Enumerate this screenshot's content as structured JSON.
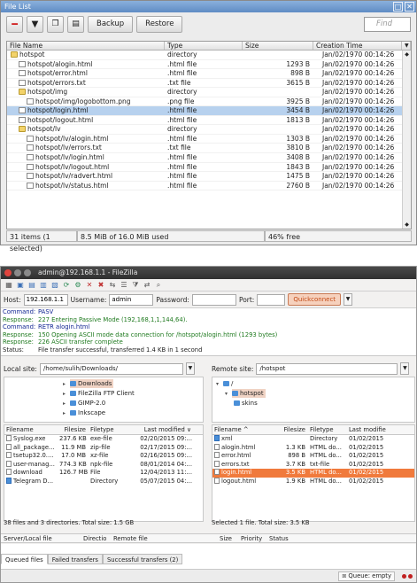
{
  "winbox": {
    "title": "File List",
    "toolbar": {
      "backup_label": "Backup",
      "restore_label": "Restore",
      "find_placeholder": "Find"
    },
    "columns": [
      "File Name",
      "Type",
      "Size",
      "Creation Time"
    ],
    "rows": [
      {
        "name": "hotspot",
        "type": "directory",
        "size": "",
        "time": "Jan/02/1970 00:14:26",
        "kind": "dir",
        "indent": 0
      },
      {
        "name": "hotspot/alogin.html",
        "type": ".html file",
        "size": "1293 B",
        "time": "Jan/02/1970 00:14:26",
        "kind": "file",
        "indent": 1
      },
      {
        "name": "hotspot/error.html",
        "type": ".html file",
        "size": "898 B",
        "time": "Jan/02/1970 00:14:26",
        "kind": "file",
        "indent": 1
      },
      {
        "name": "hotspot/errors.txt",
        "type": ".txt file",
        "size": "3615 B",
        "time": "Jan/02/1970 00:14:26",
        "kind": "file",
        "indent": 1
      },
      {
        "name": "hotspot/img",
        "type": "directory",
        "size": "",
        "time": "Jan/02/1970 00:14:26",
        "kind": "dir",
        "indent": 1
      },
      {
        "name": "hotspot/img/logobottom.png",
        "type": ".png file",
        "size": "3925 B",
        "time": "Jan/02/1970 00:14:26",
        "kind": "file",
        "indent": 2
      },
      {
        "name": "hotspot/login.html",
        "type": ".html file",
        "size": "3454 B",
        "time": "Jan/02/1970 00:14:26",
        "kind": "file",
        "indent": 1,
        "selected": true
      },
      {
        "name": "hotspot/logout.html",
        "type": ".html file",
        "size": "1813 B",
        "time": "Jan/02/1970 00:14:26",
        "kind": "file",
        "indent": 1
      },
      {
        "name": "hotspot/lv",
        "type": "directory",
        "size": "",
        "time": "Jan/02/1970 00:14:26",
        "kind": "dir",
        "indent": 1
      },
      {
        "name": "hotspot/lv/alogin.html",
        "type": ".html file",
        "size": "1303 B",
        "time": "Jan/02/1970 00:14:26",
        "kind": "file",
        "indent": 2
      },
      {
        "name": "hotspot/lv/errors.txt",
        "type": ".txt file",
        "size": "3810 B",
        "time": "Jan/02/1970 00:14:26",
        "kind": "file",
        "indent": 2
      },
      {
        "name": "hotspot/lv/login.html",
        "type": ".html file",
        "size": "3408 B",
        "time": "Jan/02/1970 00:14:26",
        "kind": "file",
        "indent": 2
      },
      {
        "name": "hotspot/lv/logout.html",
        "type": ".html file",
        "size": "1843 B",
        "time": "Jan/02/1970 00:14:26",
        "kind": "file",
        "indent": 2
      },
      {
        "name": "hotspot/lv/radvert.html",
        "type": ".html file",
        "size": "1475 B",
        "time": "Jan/02/1970 00:14:26",
        "kind": "file",
        "indent": 2
      },
      {
        "name": "hotspot/lv/status.html",
        "type": ".html file",
        "size": "2760 B",
        "time": "Jan/02/1970 00:14:26",
        "kind": "file",
        "indent": 2
      }
    ],
    "status": {
      "items": "31 items (1 selected)",
      "used": "8.5 MiB of 16.0 MiB used",
      "free": "46% free"
    }
  },
  "filezilla": {
    "title": "admin@192.168.1.1 - FileZilla",
    "quickconnect": {
      "host_label": "Host:",
      "host_value": "192.168.1.1",
      "user_label": "Username:",
      "user_value": "admin",
      "pass_label": "Password:",
      "port_label": "Port:",
      "button_label": "Quickconnect"
    },
    "log": [
      {
        "key": "Command:",
        "text": "PASV",
        "color": "navy"
      },
      {
        "key": "Response:",
        "text": "227 Entering Passive Mode (192,168,1,1,144,64).",
        "color": "green"
      },
      {
        "key": "Command:",
        "text": "RETR alogin.html",
        "color": "navy"
      },
      {
        "key": "Response:",
        "text": "150 Opening ASCII mode data connection for /hotspot/alogin.html (1293 bytes)",
        "color": "green"
      },
      {
        "key": "Response:",
        "text": "226 ASCII transfer complete",
        "color": "green"
      },
      {
        "key": "Status:",
        "text": "File transfer successful, transferred 1.4 KB in 1 second",
        "color": "plain"
      }
    ],
    "local": {
      "label": "Local site:",
      "path": "/home/sulih/Downloads/",
      "tree": [
        "Downloads",
        "FileZilla FTP Client",
        "GIMP-2.0",
        "Inkscape"
      ],
      "columns": [
        "Filename",
        "Filesize",
        "Filetype",
        "Last modified"
      ],
      "sort_indicator": "∨",
      "files": [
        {
          "name": "Syslog.exe",
          "size": "237.6 KB",
          "type": "exe-file",
          "mod": "02/20/2015 09:...",
          "dir": false
        },
        {
          "name": "all_package...",
          "size": "11.9 MB",
          "type": "zip-file",
          "mod": "02/17/2015 09:...",
          "dir": false
        },
        {
          "name": "tsetup32.0....",
          "size": "17.0 MB",
          "type": "xz-file",
          "mod": "02/16/2015 09:...",
          "dir": false
        },
        {
          "name": "user-manag...",
          "size": "774.3 KB",
          "type": "npk-file",
          "mod": "08/01/2014 04:...",
          "dir": false
        },
        {
          "name": "download",
          "size": "126.7 MB",
          "type": "File",
          "mod": "12/04/2013 11:...",
          "dir": false
        },
        {
          "name": "Telegram D...",
          "size": "",
          "type": "Directory",
          "mod": "05/07/2015 04:...",
          "dir": true
        }
      ],
      "status": "38 files and 3 directories. Total size: 1.5 GB"
    },
    "remote": {
      "label": "Remote site:",
      "path": "/hotspot",
      "tree_root": "/",
      "tree_items": [
        "hotspot",
        "skins"
      ],
      "columns": [
        "Filename",
        "Filesize",
        "Filetype",
        "Last modifie"
      ],
      "sort_indicator": "^",
      "files": [
        {
          "name": "xml",
          "size": "",
          "type": "Directory",
          "mod": "01/02/2015",
          "dir": true,
          "hl": false
        },
        {
          "name": "alogin.html",
          "size": "1.3 KB",
          "type": "HTML do...",
          "mod": "01/02/2015",
          "dir": false,
          "hl": false
        },
        {
          "name": "error.html",
          "size": "898 B",
          "type": "HTML do...",
          "mod": "01/02/2015",
          "dir": false,
          "hl": false
        },
        {
          "name": "errors.txt",
          "size": "3.7 KB",
          "type": "txt-file",
          "mod": "01/02/2015",
          "dir": false,
          "hl": false
        },
        {
          "name": "login.html",
          "size": "3.5 KB",
          "type": "HTML do...",
          "mod": "01/02/2015",
          "dir": false,
          "hl": true
        },
        {
          "name": "logout.html",
          "size": "1.9 KB",
          "type": "HTML do...",
          "mod": "01/02/2015",
          "dir": false,
          "hl": false
        }
      ],
      "status": "Selected 1 file. Total size: 3.5 KB"
    },
    "queue": {
      "columns": [
        "Server/Local file",
        "Directio",
        "Remote file",
        "Size",
        "Priority",
        "Status"
      ],
      "tabs": [
        "Queued files",
        "Failed transfers",
        "Successful transfers (2)"
      ],
      "status": "Queue: empty"
    }
  }
}
